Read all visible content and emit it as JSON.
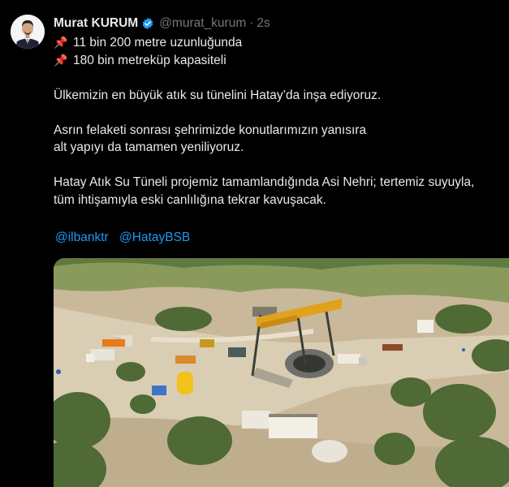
{
  "author": {
    "name": "Murat KURUM",
    "handle": "@murat_kurum",
    "separator": "·",
    "time": "2s",
    "verified_icon": "verified-badge-icon",
    "verified_color": "#1d9bf0"
  },
  "tweet": {
    "bullet_icon": "pushpin-icon",
    "bullets": [
      "11 bin 200 metre uzunluğunda",
      "180 bin metreküp kapasiteli"
    ],
    "paragraph1": "Ülkemizin en büyük atık su tünelini Hatay’da inşa ediyoruz.",
    "paragraph2": [
      "Asrın felaketi sonrası şehrimizde konutlarımızın yanısıra",
      "alt yapıyı da tamamen yeniliyoruz."
    ],
    "paragraph3": [
      "Hatay Atık Su Tüneli projemiz tamamlandığında Asi Nehri; tertemiz suyuyla,",
      "tüm ihtişamıyla eski canlılığına tekrar kavuşacak."
    ],
    "mentions": [
      "@ilbanktr",
      "@HatayBSB"
    ]
  },
  "colors": {
    "background": "#000000",
    "text": "#e7e9ea",
    "muted": "#71767b",
    "link": "#1d9bf0"
  }
}
